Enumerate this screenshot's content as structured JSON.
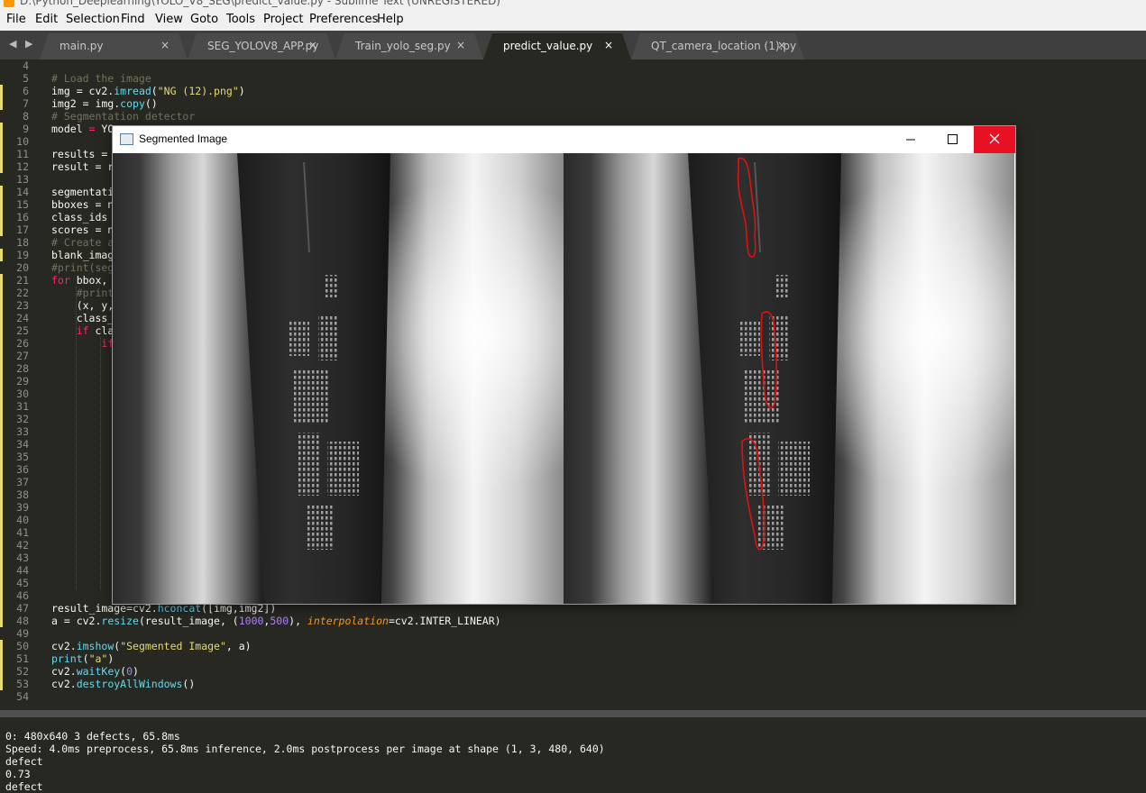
{
  "window": {
    "title": "D:\\Python_Deeplearning\\YOLO_V8_SEG\\predict_value.py - Sublime Text (UNREGISTERED)"
  },
  "menu": [
    "File",
    "Edit",
    "Selection",
    "Find",
    "View",
    "Goto",
    "Tools",
    "Project",
    "Preferences",
    "Help"
  ],
  "tabs": [
    {
      "label": "main.py",
      "active": false
    },
    {
      "label": "SEG_YOLOV8_APP.py",
      "active": false
    },
    {
      "label": "Train_yolo_seg.py",
      "active": false
    },
    {
      "label": "predict_value.py",
      "active": true
    },
    {
      "label": "QT_camera_location (1).py",
      "active": false
    }
  ],
  "tab_close_glyph": "×",
  "nav_arrows": "◀ ▶",
  "code_lines": [
    {
      "n": "4",
      "text": ""
    },
    {
      "n": "5",
      "text": "# Load the image"
    },
    {
      "n": "6",
      "text": "img = cv2.imread(\"NG (12).png\")"
    },
    {
      "n": "7",
      "text": "img2 = img.copy()"
    },
    {
      "n": "8",
      "text": "# Segmentation detector"
    },
    {
      "n": "9",
      "text": "model = YO"
    },
    {
      "n": "10",
      "text": ""
    },
    {
      "n": "11",
      "text": "results = m"
    },
    {
      "n": "12",
      "text": "result = re"
    },
    {
      "n": "13",
      "text": ""
    },
    {
      "n": "14",
      "text": "segmentatio"
    },
    {
      "n": "15",
      "text": "bboxes = np"
    },
    {
      "n": "16",
      "text": "class_ids "
    },
    {
      "n": "17",
      "text": "scores = np"
    },
    {
      "n": "18",
      "text": "# Create a"
    },
    {
      "n": "19",
      "text": "blank_image"
    },
    {
      "n": "20",
      "text": "#print(segm"
    },
    {
      "n": "21",
      "text": "for bbox, c"
    },
    {
      "n": "22",
      "text": "    #print"
    },
    {
      "n": "23",
      "text": "    (x, y,"
    },
    {
      "n": "24",
      "text": "    class_"
    },
    {
      "n": "25",
      "text": "    if cla"
    },
    {
      "n": "26",
      "text": "        if"
    },
    {
      "n": "27",
      "text": ""
    },
    {
      "n": "28",
      "text": ""
    },
    {
      "n": "29",
      "text": ""
    },
    {
      "n": "30",
      "text": ""
    },
    {
      "n": "31",
      "text": ""
    },
    {
      "n": "32",
      "text": ""
    },
    {
      "n": "33",
      "text": ""
    },
    {
      "n": "34",
      "text": ""
    },
    {
      "n": "35",
      "text": ""
    },
    {
      "n": "36",
      "text": ""
    },
    {
      "n": "37",
      "text": ""
    },
    {
      "n": "38",
      "text": ""
    },
    {
      "n": "39",
      "text": ""
    },
    {
      "n": "40",
      "text": ""
    },
    {
      "n": "41",
      "text": ""
    },
    {
      "n": "42",
      "text": ""
    },
    {
      "n": "43",
      "text": ""
    },
    {
      "n": "44",
      "text": ""
    },
    {
      "n": "45",
      "text": ""
    },
    {
      "n": "46",
      "text": ""
    },
    {
      "n": "47",
      "text": "result_image=cv2.hconcat([img,img2])"
    },
    {
      "n": "48",
      "text": "a = cv2.resize(result_image, (1000,500), interpolation=cv2.INTER_LINEAR)"
    },
    {
      "n": "49",
      "text": ""
    },
    {
      "n": "50",
      "text": "cv2.imshow(\"Segmented Image\", a)"
    },
    {
      "n": "51",
      "text": "print(\"a\")"
    },
    {
      "n": "52",
      "text": "cv2.waitKey(0)"
    },
    {
      "n": "53",
      "text": "cv2.destroyAllWindows()"
    },
    {
      "n": "54",
      "text": ""
    }
  ],
  "modified_lines": [
    "6",
    "7",
    "9",
    "10",
    "11",
    "12",
    "14",
    "15",
    "16",
    "17",
    "19",
    "21",
    "22",
    "23",
    "24",
    "25",
    "26",
    "27",
    "28",
    "29",
    "30",
    "31",
    "32",
    "33",
    "34",
    "35",
    "36",
    "37",
    "38",
    "39",
    "40",
    "41",
    "42",
    "43",
    "44",
    "45",
    "46",
    "47",
    "48",
    "50",
    "51",
    "52",
    "53"
  ],
  "console": [
    "0: 480x640 3 defects, 65.8ms",
    "Speed: 4.0ms preprocess, 65.8ms inference, 2.0ms postprocess per image at shape (1, 3, 480, 640)",
    "defect",
    "0.73",
    "defect"
  ],
  "cv_window": {
    "title": "Segmented Image",
    "minimize_icon": "minimize-icon",
    "maximize_icon": "maximize-icon",
    "close_icon": "close-icon",
    "close_color": "#e81123"
  },
  "colors": {
    "editor_bg": "#272822",
    "tab_bar_bg": "#3f3f3f",
    "comment": "#75715e",
    "string": "#e6db74",
    "function": "#66d9ef",
    "keyword": "#f92672",
    "number": "#ae81ff",
    "param": "#fd971f",
    "defect_outline": "#e01010"
  }
}
